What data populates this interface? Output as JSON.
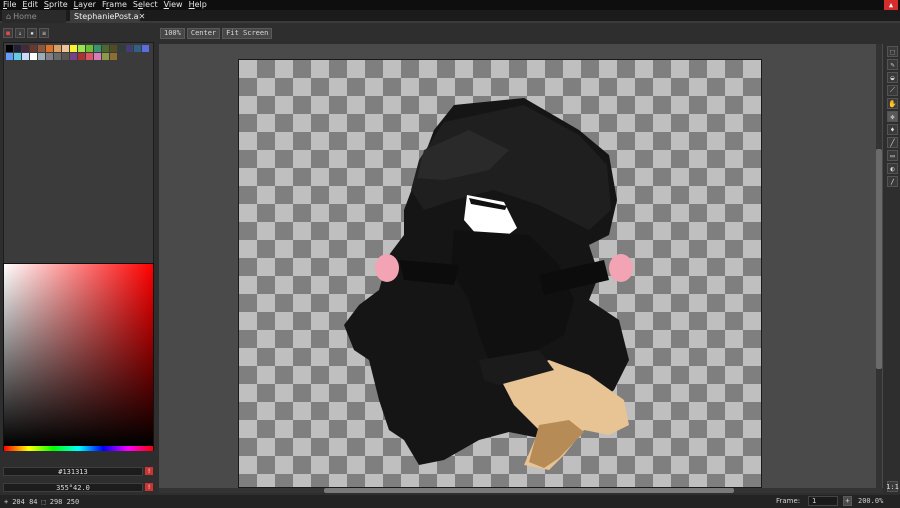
{
  "menu": [
    "File",
    "Edit",
    "Sprite",
    "Layer",
    "Frame",
    "Select",
    "View",
    "Help"
  ],
  "menu_underline": [
    "F",
    "E",
    "S",
    "L",
    "r",
    "e",
    "V",
    "H"
  ],
  "tabs": {
    "home": "Home",
    "active": "StephaniePost.a"
  },
  "palette_buttons": [
    "lock-icon",
    "arrow-down-icon",
    "save-icon",
    "menu-icon"
  ],
  "swatches": [
    "#000000",
    "#222034",
    "#45283c",
    "#663931",
    "#8f563b",
    "#df7126",
    "#d9a066",
    "#eec39a",
    "#fbf236",
    "#99e550",
    "#6abe30",
    "#37946e",
    "#4b692f",
    "#524b24",
    "#323c39",
    "#3f3f74",
    "#306082",
    "#5b6ee1",
    "#639bff",
    "#5fcde4",
    "#cbdbfc",
    "#ffffff",
    "#9badb7",
    "#847e87",
    "#696a6a",
    "#595652",
    "#76428a",
    "#ac3232",
    "#d95763",
    "#d77bba",
    "#8f974a",
    "#8a6f30"
  ],
  "color": {
    "hex": "#131313",
    "hsv": "355°42.0"
  },
  "zoom_buttons": [
    "100%",
    "Center",
    "Fit Screen"
  ],
  "tools": [
    "marquee-icon",
    "pencil-icon",
    "eraser-icon",
    "eyedropper-icon",
    "hand-icon",
    "move-icon",
    "fill-icon",
    "line-icon",
    "rect-icon",
    "ellipse-icon",
    "brush-icon"
  ],
  "tool_glyphs": [
    "⬚",
    "✎",
    "◒",
    "⟋",
    "✋",
    "✥",
    "♦",
    "╱",
    "▭",
    "◐",
    "∕"
  ],
  "status": {
    "cursor": "204  84",
    "selection": "298  250",
    "frame_label": "Frame:",
    "frame_value": "1",
    "frame_add": "+",
    "zoom": "200.0%",
    "ratio": "1:1"
  },
  "colors": {
    "accent": "#d62c2c",
    "skin": "#e8c393",
    "cloak": "#151515",
    "pink": "#f2a4b4"
  }
}
